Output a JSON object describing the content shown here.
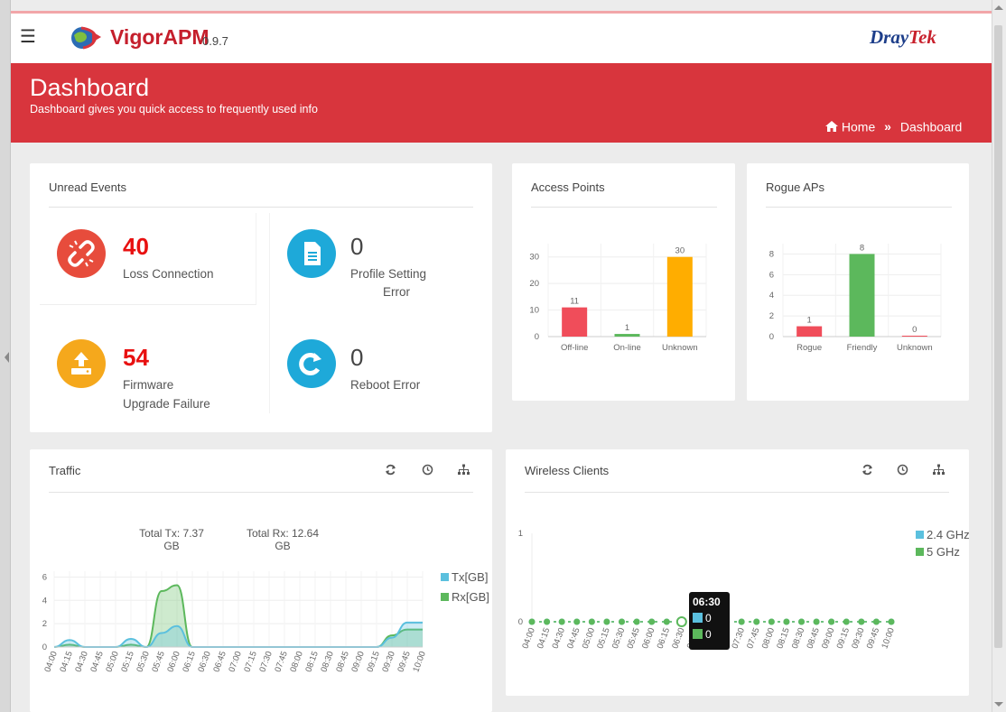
{
  "app": {
    "name": "VigorAPM",
    "version": "0.9.7",
    "vendor_prefix": "Dray",
    "vendor_suffix": "Tek"
  },
  "page": {
    "title": "Dashboard",
    "subtitle": "Dashboard gives you quick access to frequently used info"
  },
  "breadcrumb": {
    "home": "Home",
    "separator": "»",
    "current": "Dashboard"
  },
  "unread_events": {
    "title": "Unread Events",
    "items": [
      {
        "count": "40",
        "label1": "Loss Connection",
        "label2": "",
        "color": "#e74c3c",
        "icon": "broken-link-icon"
      },
      {
        "count": "0",
        "label1": "Profile Setting",
        "label2": "Error",
        "color": "#1ea9d9",
        "icon": "document-icon"
      },
      {
        "count": "54",
        "label1": "Firmware",
        "label2": "Upgrade Failure",
        "color": "#f5a81c",
        "icon": "upload-icon"
      },
      {
        "count": "0",
        "label1": "Reboot Error",
        "label2": "",
        "color": "#1ea9d9",
        "icon": "refresh-icon"
      }
    ]
  },
  "access_points": {
    "title": "Access Points"
  },
  "rogue_aps": {
    "title": "Rogue APs"
  },
  "traffic": {
    "title": "Traffic",
    "total_tx": "Total Tx: 7.37",
    "total_tx_unit": "GB",
    "total_rx": "Total Rx: 12.64",
    "total_rx_unit": "GB",
    "legend_tx": "Tx[GB]",
    "legend_rx": "Rx[GB]"
  },
  "wireless": {
    "title": "Wireless Clients",
    "legend_24": "2.4 GHz",
    "legend_5": "5 GHz",
    "tooltip": {
      "time": "06:30",
      "v24": "0",
      "v5": "0"
    }
  },
  "colors": {
    "brand_red": "#d8353d",
    "tx": "#5bc0de",
    "rx": "#5cb85c",
    "offline": "#f04d5a",
    "online": "#5cb85c",
    "unknown": "#ffad00"
  },
  "chart_data": [
    {
      "type": "bar",
      "title": "Access Points",
      "categories": [
        "Off-line",
        "On-line",
        "Unknown"
      ],
      "values": [
        11,
        1,
        30
      ],
      "ylim": [
        0,
        35
      ],
      "yticks": [
        0,
        10,
        20,
        30
      ],
      "colors": [
        "#f04d5a",
        "#5cb85c",
        "#ffad00"
      ]
    },
    {
      "type": "bar",
      "title": "Rogue APs",
      "categories": [
        "Rogue",
        "Friendly",
        "Unknown"
      ],
      "values": [
        1,
        8,
        0
      ],
      "ylim": [
        0,
        9
      ],
      "yticks": [
        0,
        2,
        4,
        6,
        8
      ],
      "colors": [
        "#f04d5a",
        "#5cb85c",
        "#f04d5a"
      ]
    },
    {
      "type": "area",
      "title": "Traffic",
      "x": [
        "04:00",
        "04:15",
        "04:30",
        "04:45",
        "05:00",
        "05:15",
        "05:30",
        "05:45",
        "06:00",
        "06:15",
        "06:30",
        "06:45",
        "07:00",
        "07:15",
        "07:30",
        "07:45",
        "08:00",
        "08:15",
        "08:30",
        "08:45",
        "09:00",
        "09:15",
        "09:30",
        "09:45",
        "10:00"
      ],
      "series": [
        {
          "name": "Tx[GB]",
          "values": [
            0,
            0.6,
            0,
            0,
            0,
            0.7,
            0,
            1.2,
            1.8,
            0,
            0,
            0,
            0,
            0,
            0,
            0,
            0,
            0,
            0,
            0,
            0,
            0,
            0.8,
            2.1,
            2.1
          ]
        },
        {
          "name": "Rx[GB]",
          "values": [
            0,
            0.2,
            0,
            0,
            0,
            0.2,
            0,
            4.8,
            5.3,
            0,
            0,
            0,
            0,
            0,
            0,
            0,
            0,
            0,
            0,
            0,
            0,
            0,
            1.0,
            1.5,
            1.5
          ]
        }
      ],
      "ylim": [
        0,
        6.5
      ],
      "yticks": [
        0,
        2,
        4,
        6
      ]
    },
    {
      "type": "line",
      "title": "Wireless Clients",
      "x": [
        "04:00",
        "04:15",
        "04:30",
        "04:45",
        "05:00",
        "05:15",
        "05:30",
        "05:45",
        "06:00",
        "06:15",
        "06:30",
        "06:45",
        "07:00",
        "07:15",
        "07:30",
        "07:45",
        "08:00",
        "08:15",
        "08:30",
        "08:45",
        "09:00",
        "09:15",
        "09:30",
        "09:45",
        "10:00"
      ],
      "series": [
        {
          "name": "2.4 GHz",
          "values": [
            0,
            0,
            0,
            0,
            0,
            0,
            0,
            0,
            0,
            0,
            0,
            0,
            0,
            0,
            0,
            0,
            0,
            0,
            0,
            0,
            0,
            0,
            0,
            0,
            0
          ]
        },
        {
          "name": "5 GHz",
          "values": [
            0,
            0,
            0,
            0,
            0,
            0,
            0,
            0,
            0,
            0,
            0,
            0,
            0,
            0,
            0,
            0,
            0,
            0,
            0,
            0,
            0,
            0,
            0,
            0,
            0
          ]
        }
      ],
      "ylim": [
        0,
        1
      ],
      "yticks": [
        0,
        1
      ]
    }
  ]
}
